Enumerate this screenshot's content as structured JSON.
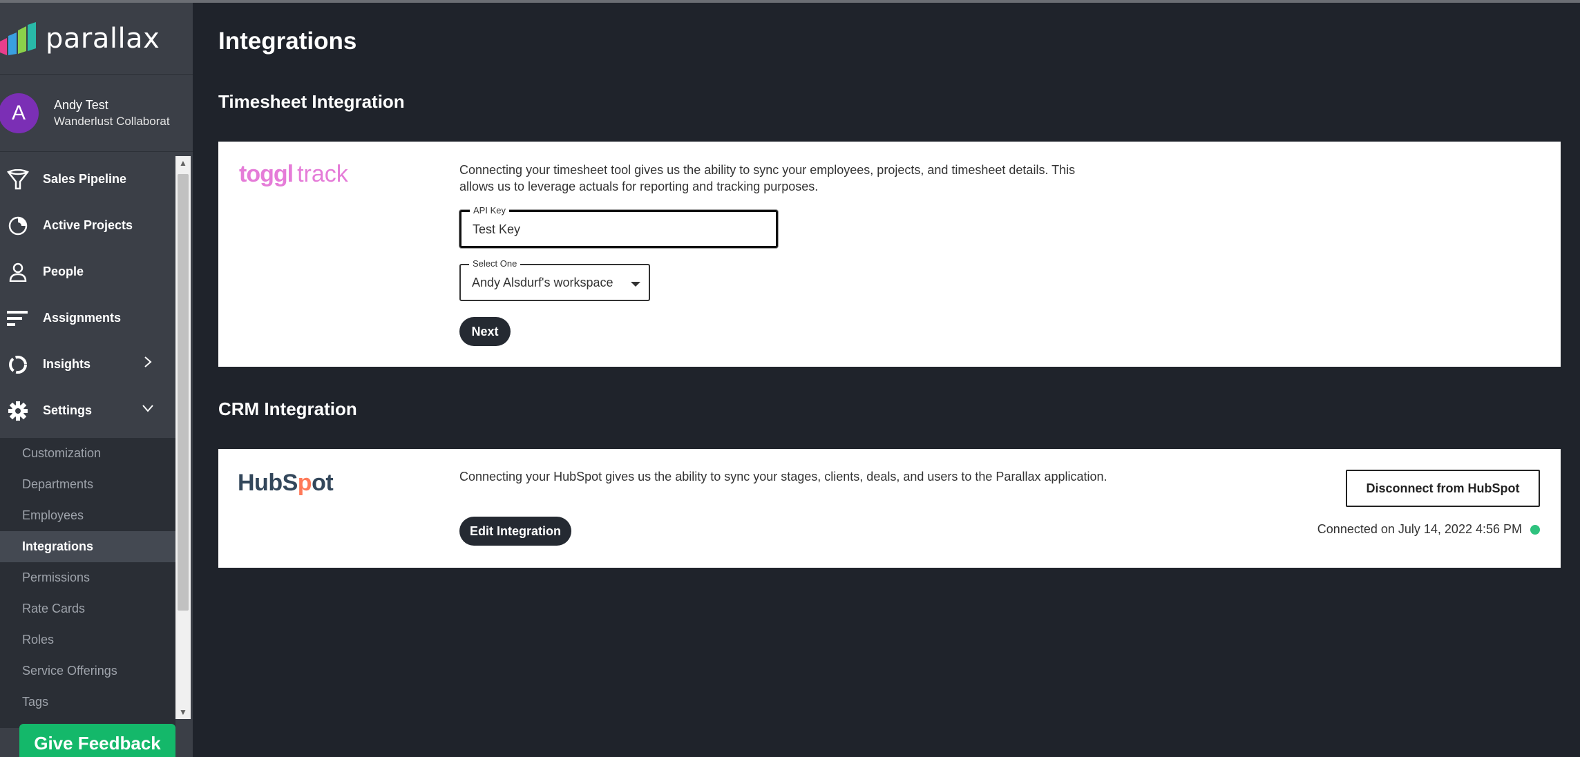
{
  "brand": {
    "name": "parallax"
  },
  "user": {
    "avatar_letter": "A",
    "name": "Andy Test",
    "organization": "Wanderlust Collaborat"
  },
  "nav": {
    "items": [
      {
        "label": "Sales Pipeline",
        "icon": "funnel-icon"
      },
      {
        "label": "Active Projects",
        "icon": "pie-chart-icon"
      },
      {
        "label": "People",
        "icon": "person-icon"
      },
      {
        "label": "Assignments",
        "icon": "bars-icon"
      },
      {
        "label": "Insights",
        "icon": "donut-icon",
        "caret": "chevron-right-icon"
      },
      {
        "label": "Settings",
        "icon": "gear-icon",
        "caret": "chevron-down-icon"
      }
    ],
    "settings_sub": [
      "Customization",
      "Departments",
      "Employees",
      "Integrations",
      "Permissions",
      "Rate Cards",
      "Roles",
      "Service Offerings",
      "Tags"
    ],
    "active_sub": "Integrations"
  },
  "feedback": {
    "label": "Give Feedback"
  },
  "page": {
    "title": "Integrations"
  },
  "timesheet": {
    "section_title": "Timesheet Integration",
    "logo_bold": "toggl",
    "logo_light": "track",
    "description": "Connecting your timesheet tool gives us the ability to sync your employees, projects, and timesheet details. This allows us to leverage actuals for reporting and tracking purposes.",
    "api_key_label": "API Key",
    "api_key_value": "Test Key",
    "select_label": "Select One",
    "select_value": "Andy Alsdurf's workspace",
    "next_label": "Next"
  },
  "crm": {
    "section_title": "CRM Integration",
    "logo_prefix": "HubS",
    "logo_o": "p",
    "logo_suffix": "ot",
    "description": "Connecting your HubSpot gives us the ability to sync your stages, clients, deals, and users to the Parallax application.",
    "edit_label": "Edit Integration",
    "disconnect_label": "Disconnect from HubSpot",
    "connected_text": "Connected on July 14, 2022 4:56 PM",
    "status_color": "#2ec27e"
  },
  "colors": {
    "background": "#1f232b",
    "sidebar": "#3b3f47",
    "accent_green": "#14b86a",
    "toggl_pink": "#e57cd8",
    "hubspot_orange": "#ff7a59"
  }
}
